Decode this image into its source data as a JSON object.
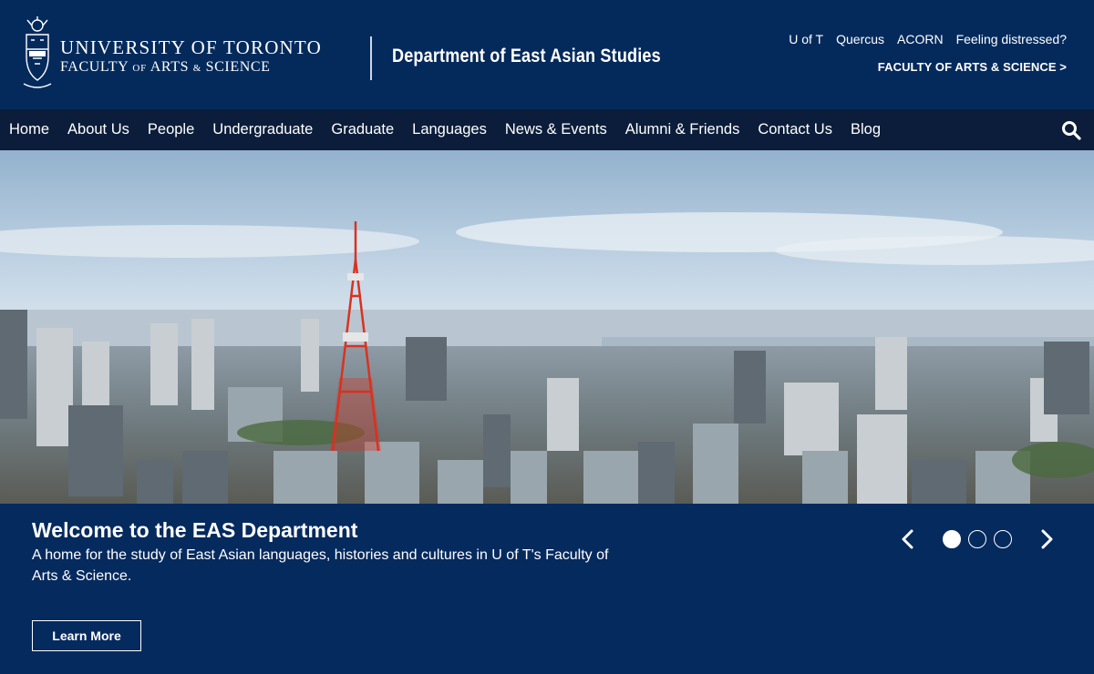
{
  "header": {
    "university_name": "UNIVERSITY OF TORONTO",
    "faculty_name_part1": "FACULTY",
    "faculty_name_of": "OF",
    "faculty_name_part2": "ARTS",
    "faculty_name_amp": "&",
    "faculty_name_part3": "SCIENCE",
    "department_title": "Department of East Asian Studies",
    "utility_links": [
      "U of T",
      "Quercus",
      "ACORN",
      "Feeling distressed?"
    ],
    "faculty_link": "FACULTY OF ARTS & SCIENCE >"
  },
  "nav": {
    "items": [
      "Home",
      "About Us",
      "People",
      "Undergraduate",
      "Graduate",
      "Languages",
      "News & Events",
      "Alumni & Friends",
      "Contact Us",
      "Blog"
    ],
    "search_icon": "search-icon"
  },
  "hero": {
    "image_subject": "tokyo-skyline-with-tower"
  },
  "caption": {
    "title": "Welcome to the EAS Department",
    "text": "A home for the study of East Asian languages, histories and cultures in U of T's Faculty of Arts & Science.",
    "button_label": "Learn More",
    "slide_count": 3,
    "active_slide": 1
  },
  "colors": {
    "header_bg": "#042a5c",
    "nav_bg": "#0b1d3a",
    "caption_bg": "#052a5e",
    "tower_red": "#d9321f"
  }
}
